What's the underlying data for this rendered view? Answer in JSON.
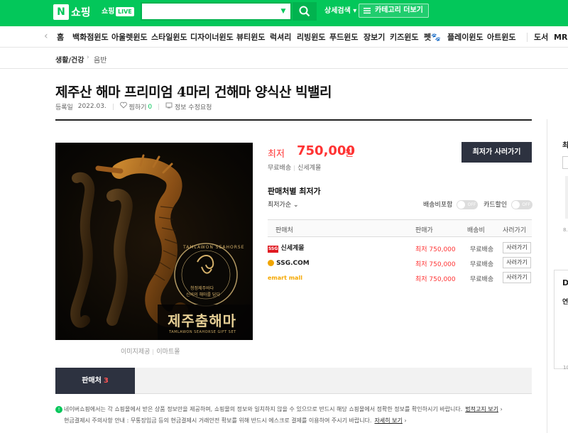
{
  "header": {
    "logo_letter": "N",
    "logo_text": "쇼핑",
    "live_label": "쇼핑",
    "live_badge": "LIVE",
    "search_placeholder": "",
    "detail_search": "상세검색",
    "category_more": "카테고리 더보기",
    "accent_color": "#03c75a"
  },
  "nav": {
    "items": [
      "홈",
      "백화점윈도",
      "아울렛윈도",
      "스타일윈도",
      "디자이너윈도",
      "뷰티윈도",
      "럭셔리",
      "리빙윈도",
      "푸드윈도",
      "장보기",
      "키즈윈도",
      "펫",
      "플레이윈도",
      "아트윈도",
      "도서",
      "MR"
    ]
  },
  "breadcrumb": {
    "level1": "생활/건강",
    "level2": "음반"
  },
  "product": {
    "title": "제주산 해마 프리미엄 4마리 건해마 양식산 빅밸리",
    "registered_label": "등록일",
    "registered_date": "2022.03.",
    "wish_label": "찜하기",
    "wish_count": "0",
    "info_request": "정보 수정요청",
    "image_text_main": "제주춤해마",
    "image_text_sub": "TAMLAWON SEAHORSE GIFT SET",
    "image_badge_line1": "청정제주바다",
    "image_badge_line2": "신비의 해마를 담다",
    "image_ring_text": "TAMLAWON SEAHORSE",
    "image_caption_1": "이미지제공",
    "image_caption_2": "이마트몰"
  },
  "price": {
    "lowest_label": "최저",
    "lowest_value": "750,000",
    "unit": "원",
    "free_shipping": "무료배송",
    "seller": "신세계몰",
    "buy_button": "최저가 사러가기"
  },
  "sellers": {
    "heading": "판매처별 최저가",
    "sort": "최저가순",
    "toggle_shipping": "배송비포함",
    "toggle_card": "카드할인",
    "toggle_off": "OFF",
    "columns": [
      "판매처",
      "판매가",
      "배송비",
      "사러가기"
    ],
    "rows": [
      {
        "mall": "신세계몰",
        "price": "최저 750,000",
        "shipping": "무료배송",
        "action": "사러가기"
      },
      {
        "mall": "SSG.COM",
        "price": "최저 750,000",
        "shipping": "무료배송",
        "action": "사러가기"
      },
      {
        "mall": "emart mall",
        "price": "최저 750,000",
        "shipping": "무료배송",
        "action": "사러가기"
      }
    ]
  },
  "tabs": {
    "seller_tab": "판매처",
    "seller_tab_count": "3"
  },
  "notice": {
    "line1": "네이버쇼핑에서는 각 쇼핑몰에서 받은 상품 정보만을 제공하며, 쇼핑몰의 정보와 일치하지 않을 수 있으므로 반드시 해당 쇼핑몰에서 정확한 정보를 확인하시기 바랍니다.",
    "line1_link": "법적고지 보기",
    "line2": "현금결제시 주의사항 안내 : 무통장입금 등의 현금결제시 거래안전 확보를 위해 반드시 에스크로 결제를 이용하여 주시기 바랍니다.",
    "line2_link": "자세히 보기"
  },
  "right_column": {
    "t1": "최",
    "t2": "8.",
    "t3": "D",
    "t4": "연",
    "t5": "10"
  }
}
